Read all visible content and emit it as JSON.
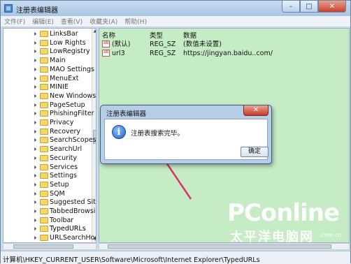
{
  "window": {
    "title": "注册表编辑器",
    "min_symbol": "–",
    "max_symbol": "□",
    "close_symbol": "✕"
  },
  "menu": [
    "文件(F)",
    "编辑(E)",
    "查看(V)",
    "收藏夹(A)",
    "帮助(H)"
  ],
  "tree": {
    "items": [
      "LinksBar",
      "Low Rights",
      "LowRegistry",
      "Main",
      "MAO Settings",
      "MenuExt",
      "MINIE",
      "New Windows",
      "PageSetup",
      "PhishingFilter",
      "Privacy",
      "Recovery",
      "SearchScopes",
      "SearchUrl",
      "Security",
      "Services",
      "Settings",
      "Setup",
      "SQM",
      "Suggested Sites",
      "TabbedBrowsing",
      "Toolbar",
      "TypedURLs",
      "URLSearchHooks"
    ],
    "selected_index": 22
  },
  "values_pane": {
    "headers": {
      "name": "名称",
      "type": "类型",
      "data": "数据"
    },
    "rows": [
      {
        "name": "(默认)",
        "type": "REG_SZ",
        "data": "(数值未设置)"
      },
      {
        "name": "url3",
        "type": "REG_SZ",
        "data": "https://jingyan.baidu..com/"
      }
    ],
    "background": "#c6ecc6"
  },
  "status_bar": {
    "path": "计算机\\HKEY_CURRENT_USER\\Software\\Microsoft\\Internet Explorer\\TypedURLs"
  },
  "dialog": {
    "title": "注册表编辑器",
    "close_symbol": "✕",
    "message": "注册表搜索完毕。",
    "ok_label": "确定",
    "icon_glyph": "i"
  },
  "annotation": {
    "arrow_color": "#d8336a"
  },
  "watermark": {
    "brand": "PConline",
    "tagline": "太平洋电脑网",
    "url": ".com.cn"
  }
}
